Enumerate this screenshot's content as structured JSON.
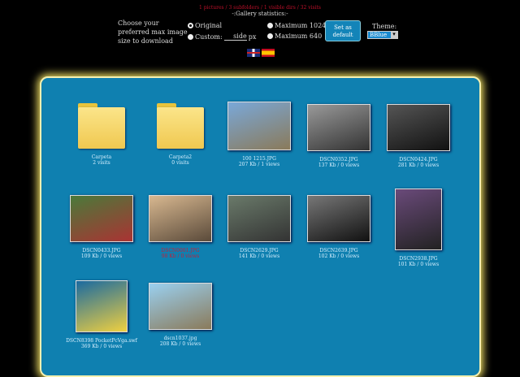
{
  "header": {
    "stats": "1 pictures / 3 subfolders / 1 visible dirs / 32 visits",
    "gallery_stats_link": "-:Gallery statistics:-",
    "choose_label": "Choose your preferred max image size to download",
    "options": {
      "original": "Original",
      "custom": "Custom:",
      "custom_value": "side",
      "custom_unit": "px",
      "max1024": "Maximum 1024",
      "max640": "Maximum 640"
    },
    "selected_option": "original",
    "set_default": "Set as default",
    "theme_label": "Theme:",
    "theme_value": "BBlue",
    "languages": [
      "english",
      "spanish"
    ]
  },
  "items": [
    {
      "type": "folder",
      "name": "Carpeta",
      "info": "2 visits"
    },
    {
      "type": "folder",
      "name": "Carpeta2",
      "info": "0 visits"
    },
    {
      "type": "image",
      "name": "100 1215.JPG",
      "info": "207 Kb / 1 views",
      "colors": [
        "#7aa8d8",
        "#8a7a5a"
      ]
    },
    {
      "type": "image",
      "name": "DSCN0352.JPG",
      "info": "137 Kb / 0 views",
      "colors": [
        "#999",
        "#333"
      ]
    },
    {
      "type": "image",
      "name": "DSCN0424.JPG",
      "info": "281 Kb / 0 views",
      "colors": [
        "#555",
        "#111"
      ]
    },
    {
      "type": "image",
      "name": "DSCN0433.JPG",
      "info": "109 Kb / 0 views",
      "colors": [
        "#4a7a3a",
        "#a33"
      ]
    },
    {
      "type": "image",
      "name": "DSCN0001.JPG",
      "info": "98 Kb / 0 views",
      "colors": [
        "#d8b890",
        "#5a4a3a"
      ],
      "highlight": true
    },
    {
      "type": "image",
      "name": "DSCN2629.JPG",
      "info": "141 Kb / 0 views",
      "colors": [
        "#6a7a6a",
        "#333"
      ]
    },
    {
      "type": "image",
      "name": "DSCN2639.JPG",
      "info": "102 Kb / 0 views",
      "colors": [
        "#777",
        "#111"
      ]
    },
    {
      "type": "image",
      "name": "DSCN2938.JPG",
      "info": "101 Kb / 0 views",
      "colors": [
        "#6a4a7a",
        "#222"
      ]
    },
    {
      "type": "image",
      "name": "DSCN8398 PocketPcVga.swf",
      "info": "369 Kb / 0 views",
      "colors": [
        "#1a6aa0",
        "#f0d040"
      ]
    },
    {
      "type": "image",
      "name": "dscn1037.jpg",
      "info": "208 Kb / 0 views",
      "colors": [
        "#9ad0f0",
        "#8a7a5a"
      ]
    }
  ]
}
